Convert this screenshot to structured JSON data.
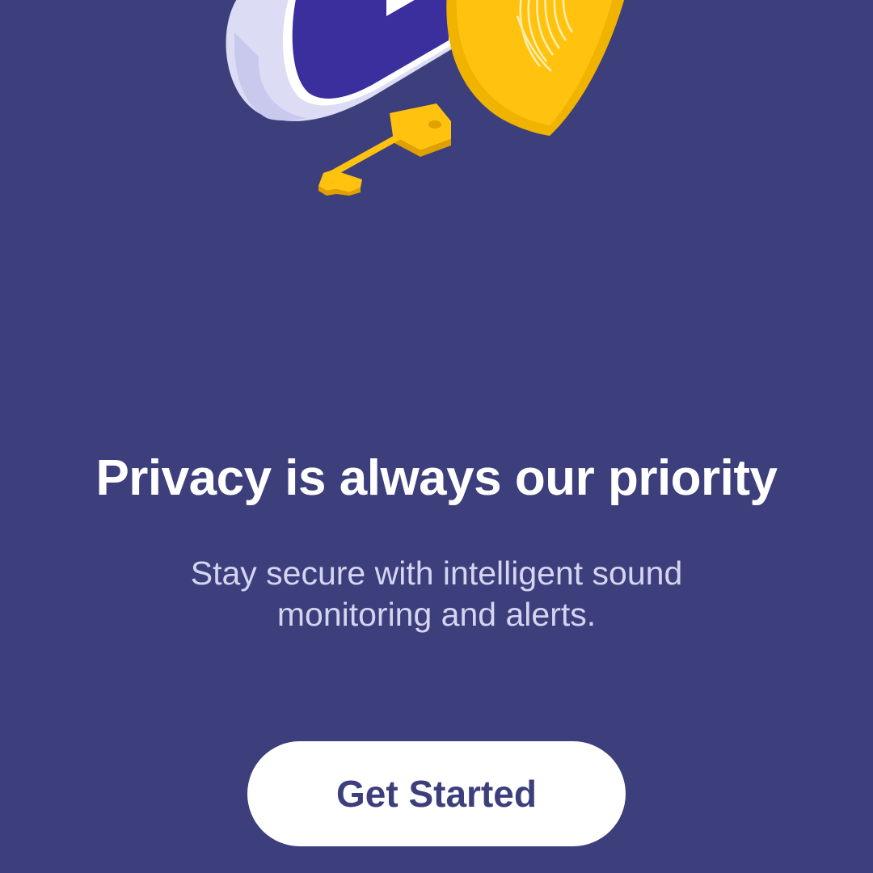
{
  "onboarding": {
    "title": "Privacy is always our priority",
    "subtitle": "Stay secure with intelligent sound monitoring and alerts.",
    "cta_label": "Get Started"
  },
  "illustration": {
    "icons": [
      "cloud-lock-icon",
      "fingerprint-shield-icon",
      "key-icon"
    ]
  },
  "colors": {
    "background": "#3d3f7c",
    "title": "#ffffff",
    "subtitle": "#d4d5f1",
    "button_bg": "#ffffff",
    "button_text": "#3d3f7c",
    "accent_gold": "#ffc20e",
    "cloud_dark": "#3b2f9e",
    "cloud_light": "#dcdcf5"
  }
}
